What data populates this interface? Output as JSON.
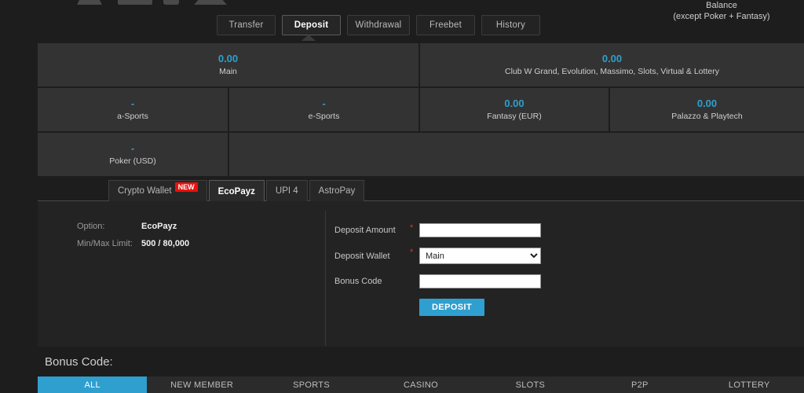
{
  "header": {
    "balance_title": "Balance",
    "balance_subtitle": "(except Poker + Fantasy)",
    "logos": [
      "logo-placeholder-1",
      "logo-placeholder-2",
      "logo-placeholder-3",
      "logo-placeholder-4"
    ]
  },
  "nav_tabs": [
    {
      "label": "Transfer",
      "active": false
    },
    {
      "label": "Deposit",
      "active": true
    },
    {
      "label": "Withdrawal",
      "active": false
    },
    {
      "label": "Freebet",
      "active": false
    },
    {
      "label": "History",
      "active": false
    }
  ],
  "balances": {
    "row1": [
      {
        "amount": "0.00",
        "name": "Main"
      },
      {
        "amount": "0.00",
        "name": "Club W Grand, Evolution, Massimo, Slots, Virtual & Lottery"
      }
    ],
    "row2": [
      {
        "amount": "-",
        "name": "a-Sports"
      },
      {
        "amount": "-",
        "name": "e-Sports"
      },
      {
        "amount": "0.00",
        "name": "Fantasy (EUR)"
      },
      {
        "amount": "0.00",
        "name": "Palazzo & Playtech"
      }
    ],
    "row3": [
      {
        "amount": "-",
        "name": "Poker (USD)"
      }
    ]
  },
  "method_tabs": [
    {
      "label": "Crypto Wallet",
      "badge": "NEW",
      "active": false
    },
    {
      "label": "EcoPayz",
      "badge": "",
      "active": true
    },
    {
      "label": "UPI 4",
      "badge": "",
      "active": false
    },
    {
      "label": "AstroPay",
      "badge": "",
      "active": false
    }
  ],
  "info": {
    "option_label": "Option:",
    "option_value": "EcoPayz",
    "limit_label": "Min/Max Limit:",
    "limit_value": "500 / 80,000"
  },
  "form": {
    "amount_label": "Deposit Amount",
    "amount_value": "",
    "amount_required": "*",
    "wallet_label": "Deposit Wallet",
    "wallet_required": "*",
    "wallet_value": "Main",
    "wallet_options": [
      "Main"
    ],
    "bonus_label": "Bonus Code",
    "bonus_value": "",
    "submit_label": "DEPOSIT"
  },
  "bonus": {
    "title": "Bonus Code:",
    "categories": [
      {
        "label": "ALL",
        "active": true
      },
      {
        "label": "NEW MEMBER",
        "active": false
      },
      {
        "label": "SPORTS",
        "active": false
      },
      {
        "label": "CASINO",
        "active": false
      },
      {
        "label": "SLOTS",
        "active": false
      },
      {
        "label": "P2P",
        "active": false
      },
      {
        "label": "LOTTERY",
        "active": false
      }
    ]
  },
  "colors": {
    "accent": "#2f9fd0",
    "badge": "#e8110f",
    "required": "#d23b2e",
    "page_bg": "#1d1d1d",
    "cell_bg": "#333333"
  }
}
